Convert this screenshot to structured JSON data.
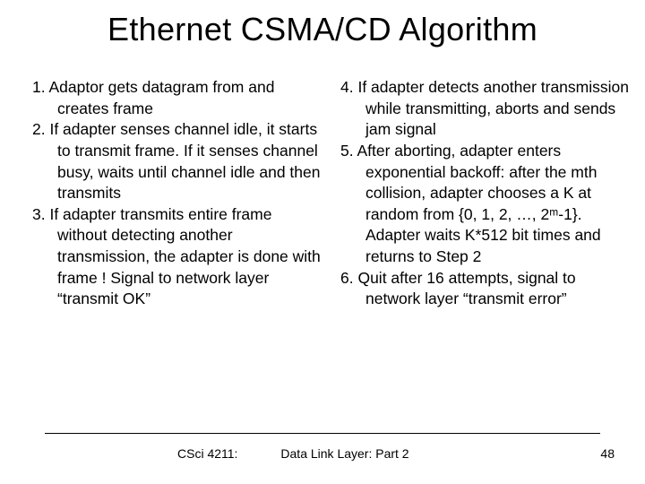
{
  "title": "Ethernet CSMA/CD Algorithm",
  "left": {
    "item1": "1. Adaptor gets datagram from and creates frame",
    "item2": "2. If adapter senses channel idle, it starts to transmit frame. If it senses channel busy, waits until channel idle and then transmits",
    "item3": "3. If adapter transmits entire frame without detecting another transmission, the adapter is done with frame ! Signal to network layer “transmit OK”"
  },
  "right": {
    "item4": "4. If adapter detects another transmission while transmitting, aborts and sends jam signal",
    "item5": "5. After aborting, adapter enters exponential backoff: after the mth collision, adapter chooses a K at random from {0, 1, 2, …, 2ᵐ-1}. Adapter waits K*512 bit times and returns to Step 2",
    "item6": "6.  Quit after 16 attempts, signal to network layer “transmit error”"
  },
  "footer": {
    "left": "CSci 4211:",
    "center": "Data Link Layer: Part 2",
    "page": "48"
  }
}
